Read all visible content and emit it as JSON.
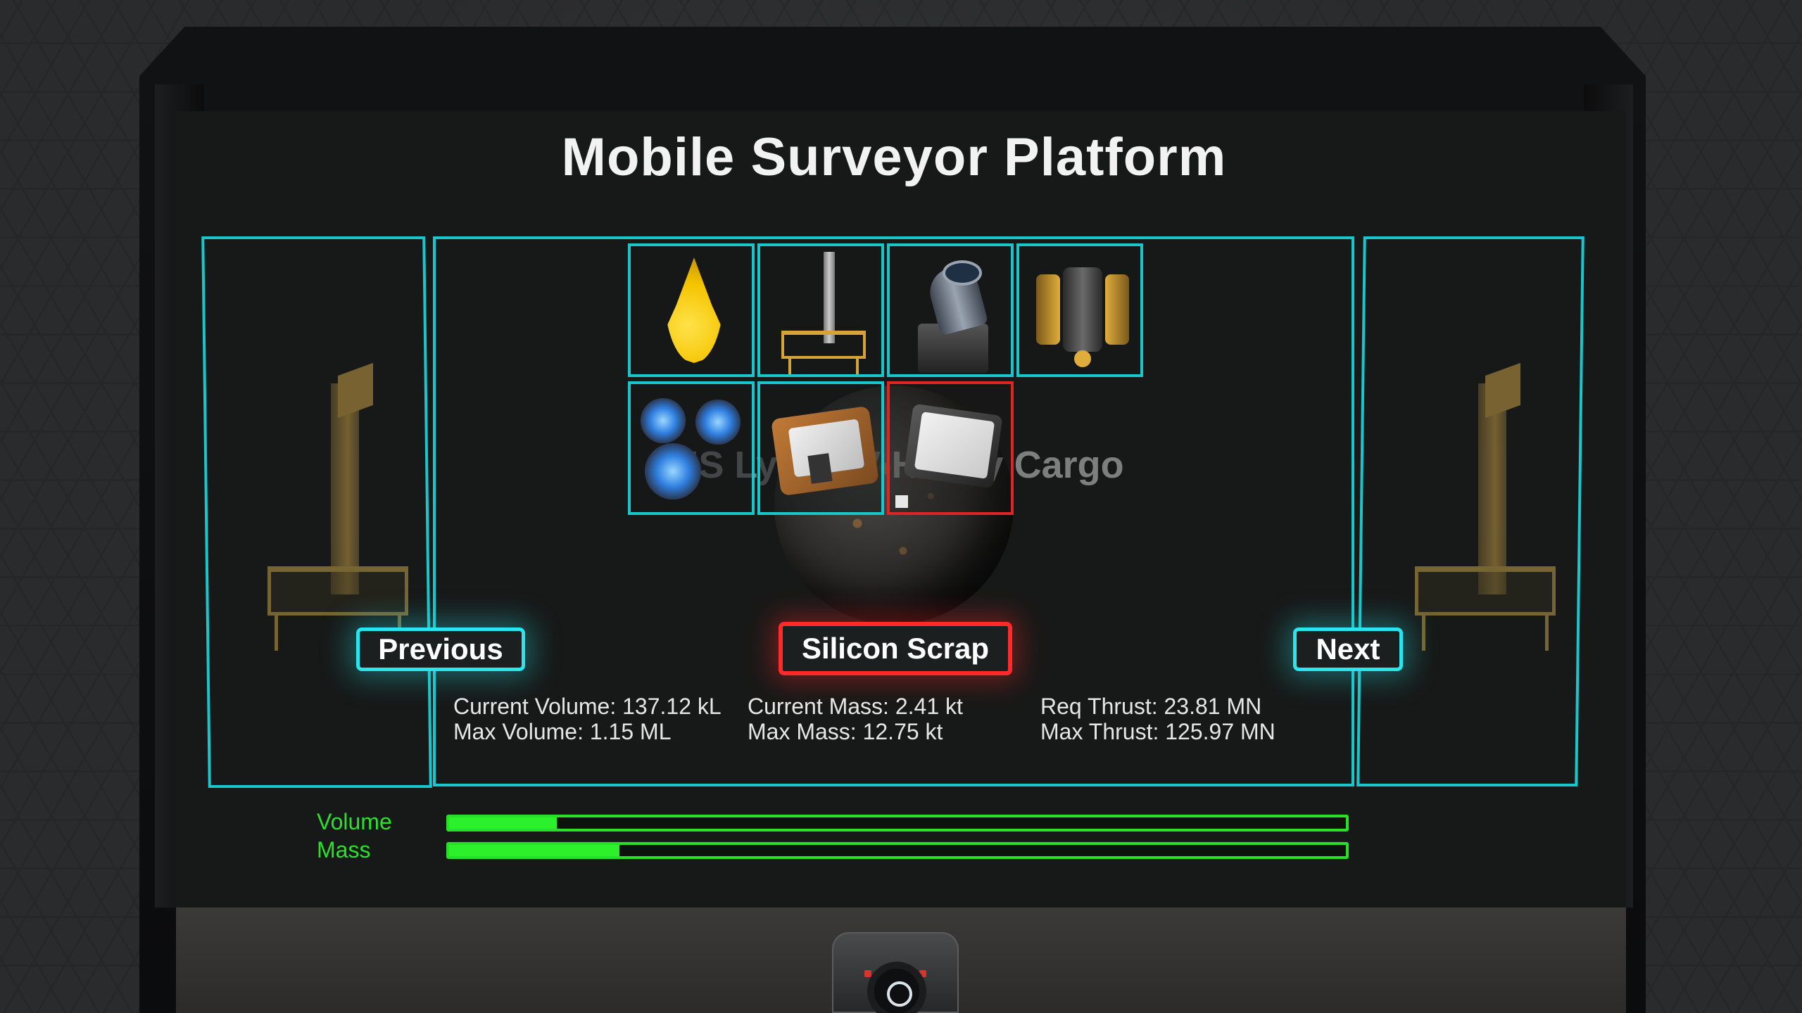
{
  "title": "Mobile Surveyor Platform",
  "ship_name": "HS Lycon V Heavy Cargo",
  "nav": {
    "previous_label": "Previous",
    "next_label": "Next"
  },
  "selected_item_label": "Silicon Scrap",
  "items": [
    {
      "icon": "fuel-drop-icon"
    },
    {
      "icon": "drilling-rig-icon"
    },
    {
      "icon": "telescope-icon"
    },
    {
      "icon": "drone-icon"
    },
    {
      "icon": "fuel-cells-icon"
    },
    {
      "icon": "scrap-plate-icon"
    },
    {
      "icon": "silicon-scrap-icon",
      "selected": true
    }
  ],
  "stats": {
    "current_volume": "Current Volume: 137.12 kL",
    "max_volume": "Max Volume: 1.15 ML",
    "current_mass": "Current Mass: 2.41 kt",
    "max_mass": "Max Mass: 12.75 kt",
    "req_thrust": "Req Thrust: 23.81 MN",
    "max_thrust": "Max Thrust: 125.97 MN"
  },
  "bars": {
    "volume_label": "Volume",
    "mass_label": "Mass",
    "volume_fill": 0.12,
    "mass_fill": 0.19
  },
  "colors": {
    "cyan_border": "#18c6cc",
    "selected_border": "#e02424",
    "bar_green": "#2bf02b"
  }
}
